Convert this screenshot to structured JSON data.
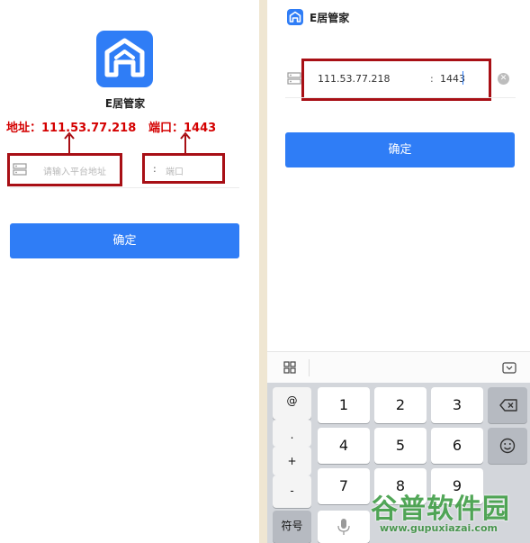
{
  "left": {
    "app_name": "E居管家",
    "annotation_address": "地址：111.53.77.218",
    "annotation_port": "端口：1443",
    "address_placeholder": "请输入平台地址",
    "colon": ":",
    "port_placeholder": "端口",
    "confirm_label": "确定"
  },
  "right": {
    "title": "E居管家",
    "address_value": "111.53.77.218",
    "colon": ":",
    "port_value": "1443",
    "clear_icon": "clear-icon",
    "confirm_label": "确定"
  },
  "keyboard": {
    "sym_keys": [
      "@",
      ".",
      "+",
      "-"
    ],
    "digit_keys": [
      "1",
      "2",
      "3",
      "4",
      "5",
      "6",
      "7",
      "8",
      "9"
    ],
    "symbol_switch": "符号",
    "icons": [
      "grid-icon",
      "keyboard-hide-icon",
      "backspace-icon",
      "emoji-icon",
      "mic-icon"
    ]
  },
  "watermark": {
    "text": "谷普软件园",
    "url": "www.gupuxiazai.com"
  },
  "colors": {
    "accent": "#2f7df6",
    "annotation": "#d40000",
    "box": "#a80f15"
  }
}
